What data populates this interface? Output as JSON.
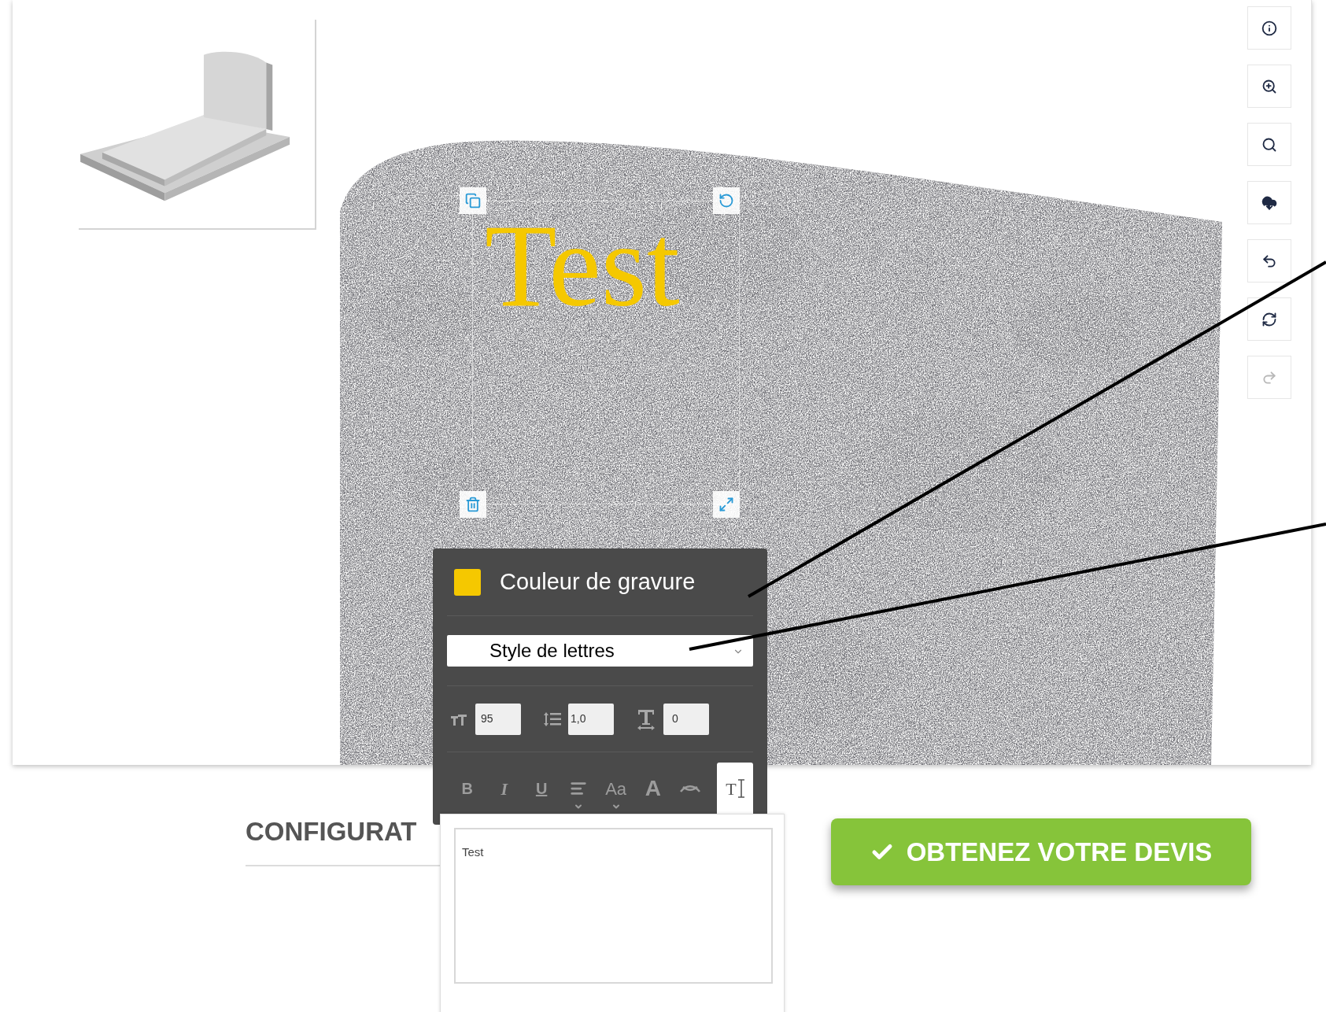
{
  "canvas_text": "Test",
  "toolbar_buttons": [
    {
      "kind": "info",
      "disabled": false
    },
    {
      "kind": "zoom-in",
      "disabled": false
    },
    {
      "kind": "search",
      "disabled": false
    },
    {
      "kind": "download",
      "disabled": false
    },
    {
      "kind": "undo",
      "disabled": false
    },
    {
      "kind": "refresh",
      "disabled": false
    },
    {
      "kind": "redo",
      "disabled": true
    }
  ],
  "text_panel": {
    "color_label": "Couleur de gravure",
    "font_select": {
      "value": "Style de lettres"
    },
    "size_field": {
      "value": "95"
    },
    "line_height_field": {
      "value": "1,0"
    },
    "spacing_field": {
      "value": "0"
    },
    "format_buttons": [
      {
        "kind": "bold",
        "label": "B",
        "selected": false
      },
      {
        "kind": "italic",
        "label": "I",
        "selected": false
      },
      {
        "kind": "underline",
        "label": "U",
        "selected": false
      },
      {
        "kind": "align",
        "selected": false
      },
      {
        "kind": "case",
        "label": "Aa",
        "selected": false
      },
      {
        "kind": "outline",
        "label": "A",
        "selected": false
      },
      {
        "kind": "curve",
        "selected": false
      },
      {
        "kind": "text",
        "label": "T",
        "selected": true
      }
    ],
    "text_area": {
      "value": "Test"
    }
  },
  "section_heading": "CONFIGURAT",
  "quote_button": {
    "label": "OBTENEZ VOTRE DEVIS"
  }
}
